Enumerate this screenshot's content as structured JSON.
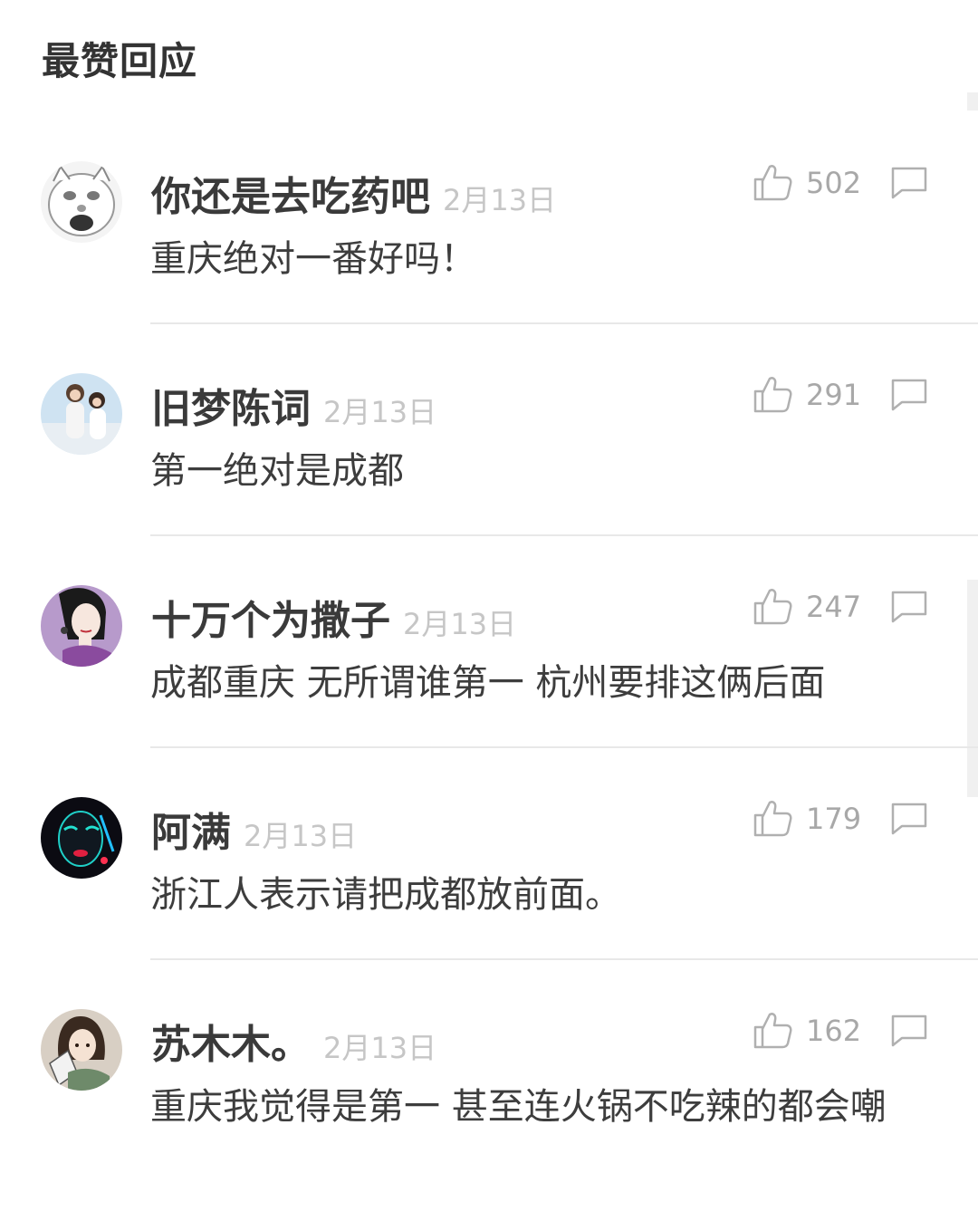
{
  "section": {
    "title": "最赞回应"
  },
  "comments": [
    {
      "user": "你还是去吃药吧",
      "date": "2月13日",
      "likes": "502",
      "text": "重庆绝对一番好吗！",
      "avatar": "meme-face-avatar"
    },
    {
      "user": "旧梦陈词",
      "date": "2月13日",
      "likes": "291",
      "text": "第一绝对是成都",
      "avatar": "couple-photo-avatar"
    },
    {
      "user": "十万个为撒子",
      "date": "2月13日",
      "likes": "247",
      "text": "成都重庆 无所谓谁第一 杭州要排这俩后面",
      "avatar": "illustrated-woman-avatar"
    },
    {
      "user": "阿满",
      "date": "2月13日",
      "likes": "179",
      "text": "浙江人表示请把成都放前面。",
      "avatar": "neon-face-avatar"
    },
    {
      "user": "苏木木。",
      "date": "2月13日",
      "likes": "162",
      "text": "重庆我觉得是第一 甚至连火锅不吃辣的都会嘲",
      "avatar": "anime-girl-avatar"
    }
  ],
  "colors": {
    "username": "#3a3a3a",
    "date": "#c6c6c6",
    "count": "#a8a8a8",
    "divider": "#e8e8e8"
  },
  "icons": {
    "like": "thumbs-up-icon",
    "reply": "speech-bubble-icon"
  }
}
